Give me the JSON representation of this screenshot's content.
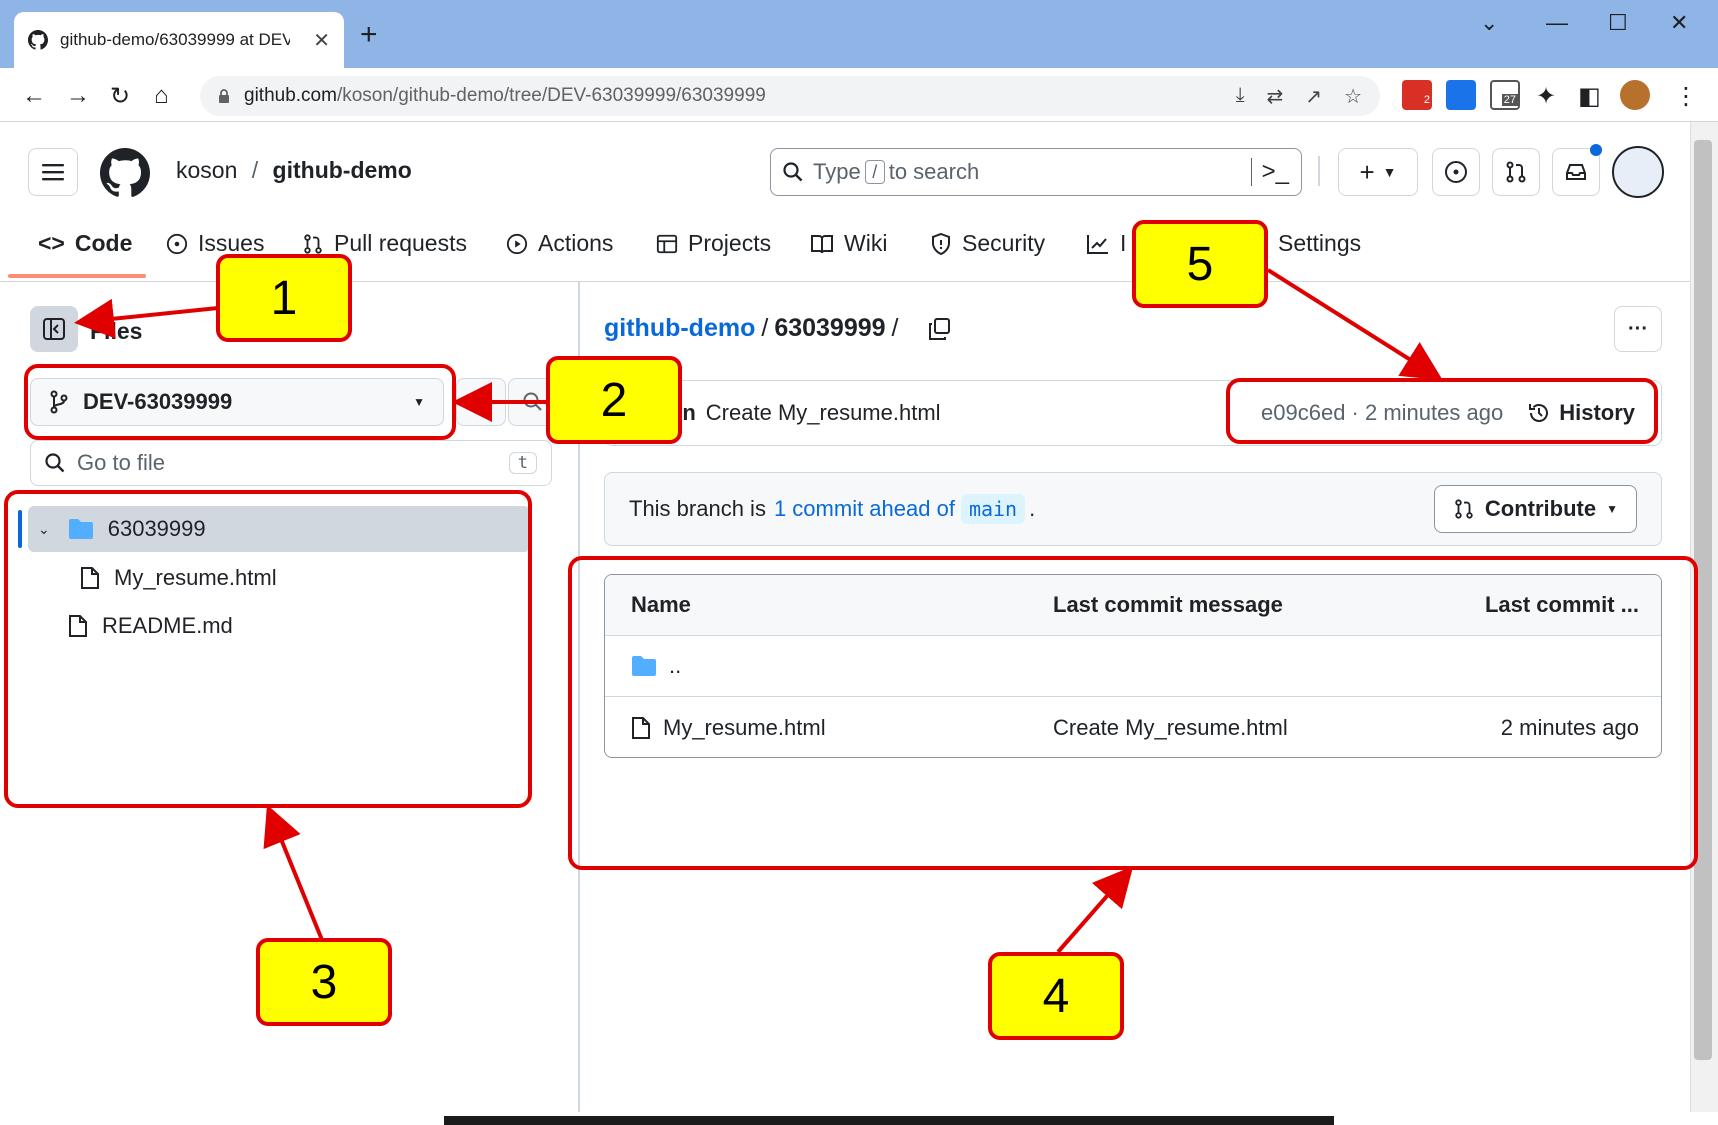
{
  "browser": {
    "tab_title": "github-demo/63039999 at DEV-",
    "url_host": "github.com",
    "url_path": "/koson/github-demo/tree/DEV-63039999/63039999",
    "new_tab_glyph": "+",
    "ext_badges": {
      "mail": "2",
      "calendar": "27"
    }
  },
  "header": {
    "owner": "koson",
    "separator": "/",
    "repo": "github-demo",
    "search": {
      "prefix": "Type",
      "slash": "/",
      "suffix": "to search"
    }
  },
  "nav_tabs": [
    {
      "label": "Code",
      "icon": "code-icon"
    },
    {
      "label": "Issues",
      "icon": "issue-icon"
    },
    {
      "label": "Pull requests",
      "icon": "pull-request-icon"
    },
    {
      "label": "Actions",
      "icon": "play-icon"
    },
    {
      "label": "Projects",
      "icon": "table-icon"
    },
    {
      "label": "Wiki",
      "icon": "book-icon"
    },
    {
      "label": "Security",
      "icon": "shield-icon"
    },
    {
      "label": "I",
      "icon": "graph-icon"
    },
    {
      "label": "Settings",
      "icon": "gear-icon"
    }
  ],
  "sidebar": {
    "title": "Files",
    "branch": "DEV-63039999",
    "goto": {
      "placeholder": "Go to file",
      "shortcut": "t"
    },
    "tree": [
      {
        "name": "63039999",
        "type": "folder",
        "selected": true
      },
      {
        "name": "My_resume.html",
        "type": "file"
      },
      {
        "name": "README.md",
        "type": "file"
      }
    ]
  },
  "main": {
    "path_repo": "github-demo",
    "path_sep": "/",
    "path_dir": "63039999",
    "path_trailing": "/",
    "more_glyph": "···",
    "commit": {
      "author": "koson",
      "message": "Create My_resume.html",
      "meta": "e09c6ed · 2 minutes ago",
      "history_label": "History"
    },
    "branch_info": {
      "prefix": "This branch is",
      "link": "1 commit ahead of",
      "base": "main",
      "suffix": ".",
      "contribute_label": "Contribute"
    },
    "table": {
      "headers": [
        "Name",
        "Last commit message",
        "Last commit ..."
      ],
      "parent_label": "..",
      "rows": [
        {
          "name": "My_resume.html",
          "message": "Create My_resume.html",
          "date": "2 minutes ago"
        }
      ]
    }
  },
  "callouts": [
    "1",
    "2",
    "3",
    "4",
    "5"
  ],
  "colors": {
    "accent_link": "#0969da",
    "callout_fill": "#ffff00",
    "callout_border": "#e00000",
    "tab_strip": "#8fb4e6",
    "selected_row": "#d0d7de"
  }
}
